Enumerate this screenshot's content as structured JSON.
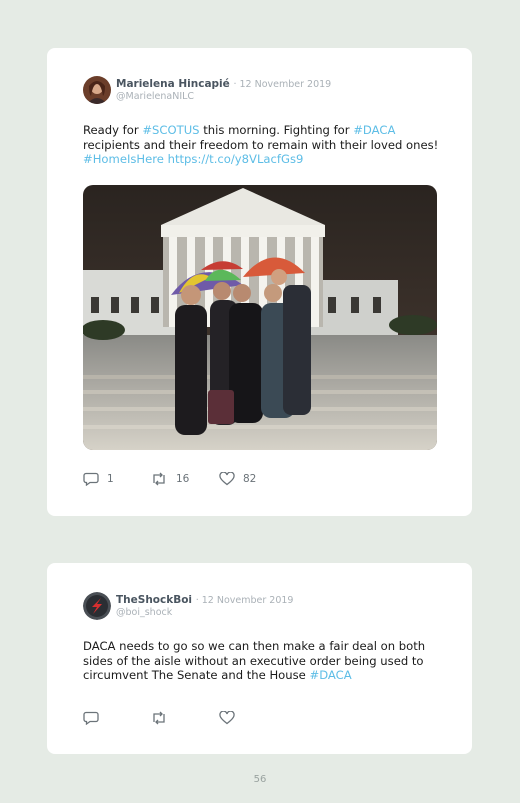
{
  "tweets": [
    {
      "author": "Marielena Hincapié",
      "date": "· 12 November 2019",
      "handle": "@MarielenaNILC",
      "text_line1_a": "Ready for ",
      "text_line1_tag1": "#SCOTUS",
      "text_line1_b": " this morning. Fighting for ",
      "text_line1_tag2": "#DACA",
      "text_line2": "recipients and their freedom to remain with their loved ones!",
      "text_line3_tag": "#HomeIsHere",
      "text_line3_link": " https://t.co/y8VLacfGs9",
      "replies": "1",
      "retweets": "16",
      "likes": "82"
    },
    {
      "author": "TheShockBoi",
      "date": "· 12 November 2019",
      "handle": "@boi_shock",
      "text_line1": "DACA needs to go so we can then make a fair deal on both",
      "text_line2": "sides of the aisle without an executive order being used to",
      "text_line3_a": "circumvent The Senate and the House ",
      "text_line3_tag": "#DACA"
    }
  ],
  "page_number": "56",
  "colors": {
    "background": "#e5ebe5",
    "card": "#ffffff",
    "hashtag": "#5dbde6",
    "meta": "#aab1b7"
  }
}
